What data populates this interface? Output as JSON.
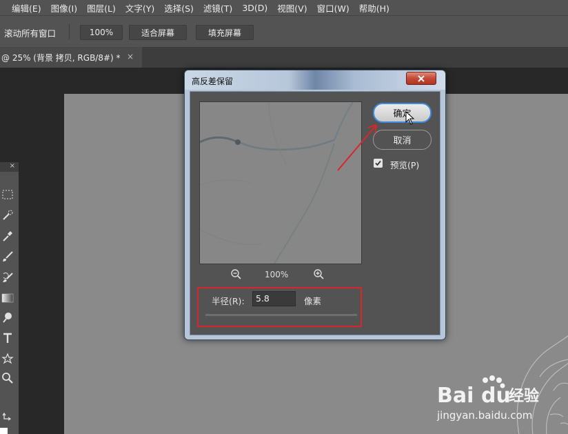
{
  "menu": {
    "items": [
      "编辑(E)",
      "图像(I)",
      "图层(L)",
      "文字(Y)",
      "选择(S)",
      "滤镜(T)",
      "3D(D)",
      "视图(V)",
      "窗口(W)",
      "帮助(H)"
    ]
  },
  "options_bar": {
    "scroll_all_label": "滚动所有窗口",
    "zoom_100": "100%",
    "fit_screen": "适合屏幕",
    "fill_screen": "填充屏幕"
  },
  "document_tab": {
    "title": "@ 25% (背景 拷贝, RGB/8#) *",
    "close": "×"
  },
  "tools_panel": {
    "close": "×",
    "icons": [
      "marquee-icon",
      "quick-select-icon",
      "eyedropper-icon",
      "brush-icon",
      "history-brush-icon",
      "gradient-icon",
      "dodge-icon",
      "type-icon",
      "custom-shape-icon",
      "zoom-icon",
      "swap-colors-icon"
    ]
  },
  "dialog": {
    "title": "高反差保留",
    "ok_label": "确定",
    "cancel_label": "取消",
    "preview_label": "预览(P)",
    "preview_checked": true,
    "zoom_level": "100%",
    "radius_label": "半径(R):",
    "radius_value": "5.8",
    "radius_unit": "像素",
    "radius_slider_fraction": 0.29
  },
  "watermark": {
    "brand_prefix": "Bai",
    "brand_suffix": "du",
    "brand_cn": "经验",
    "url": "jingyan.baidu.com"
  },
  "colors": {
    "ui_bg": "#535353",
    "workspace": "#282828",
    "canvas": "#8a8a8a",
    "annotation_red": "#d9262b",
    "ok_border": "#3f8be0",
    "close_red": "#c34a36"
  }
}
